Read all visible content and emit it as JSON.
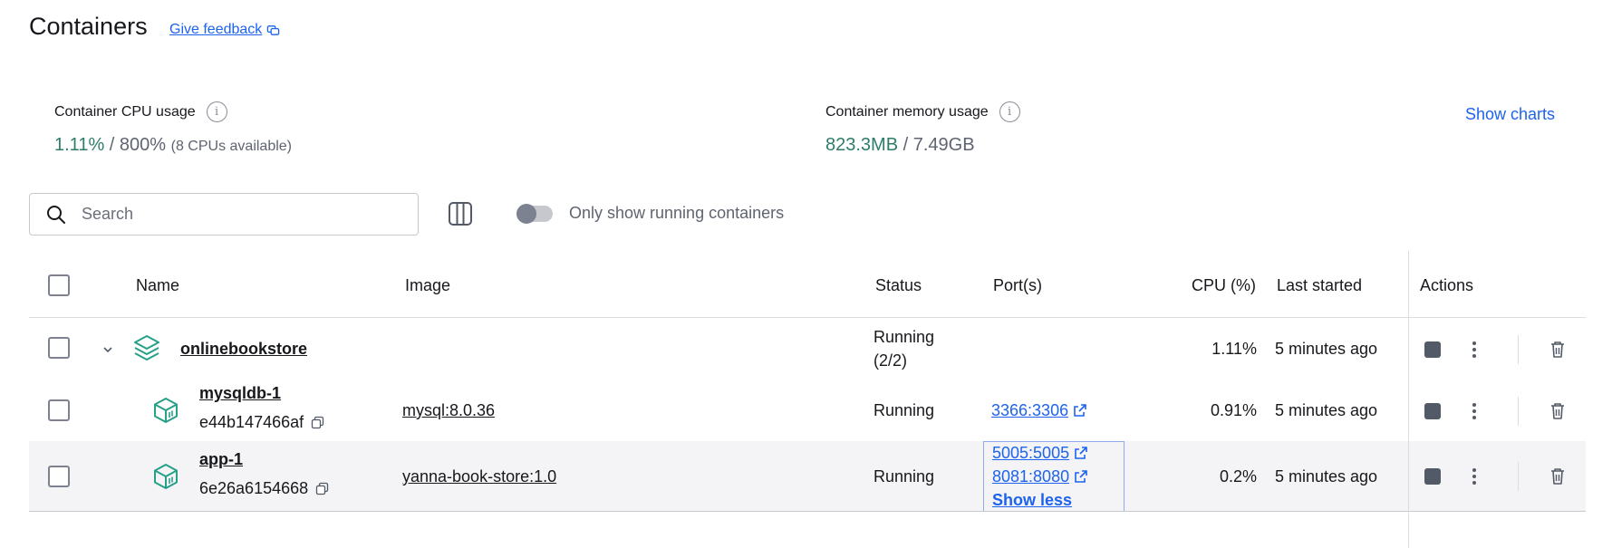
{
  "header": {
    "title": "Containers",
    "feedback_label": "Give feedback"
  },
  "stats": {
    "cpu": {
      "label": "Container CPU usage",
      "used": "1.11%",
      "separator": "/ 800%",
      "note": "(8 CPUs available)"
    },
    "memory": {
      "label": "Container memory usage",
      "used": "823.3MB",
      "separator": "/ 7.49GB"
    },
    "show_charts_label": "Show charts"
  },
  "toolbar": {
    "search_placeholder": "Search",
    "toggle_label": "Only show running containers",
    "toggle_on": false
  },
  "table": {
    "columns": [
      "Name",
      "Image",
      "Status",
      "Port(s)",
      "CPU (%)",
      "Last started",
      "Actions"
    ],
    "group": {
      "name": "onlinebookstore",
      "status_line1": "Running",
      "status_line2": "(2/2)",
      "cpu": "1.11%",
      "last_started": "5 minutes ago"
    },
    "containers": [
      {
        "name": "mysqldb-1",
        "id": "e44b147466af",
        "image": "mysql:8.0.36",
        "status": "Running",
        "ports": [
          "3366:3306"
        ],
        "cpu": "0.91%",
        "last_started": "5 minutes ago"
      },
      {
        "name": "app-1",
        "id": "6e26a6154668",
        "image": "yanna-book-store:1.0",
        "status": "Running",
        "ports": [
          "5005:5005",
          "8081:8080"
        ],
        "ports_toggle": "Show less",
        "cpu": "0.2%",
        "last_started": "5 minutes ago"
      }
    ]
  },
  "colors": {
    "accent": "#1d63ed",
    "green": "#2e7d6b",
    "icon_teal": "#27a088"
  }
}
